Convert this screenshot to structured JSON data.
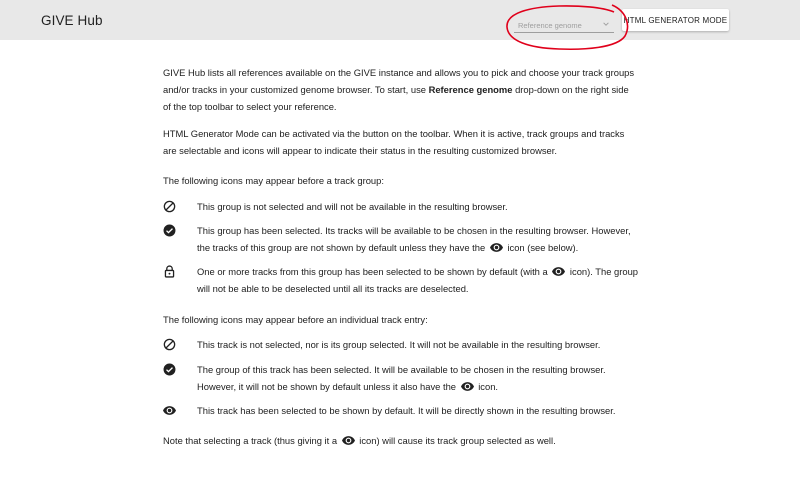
{
  "toolbar": {
    "title": "GIVE Hub",
    "reference_placeholder": "Reference genome",
    "mode_button": "HTML GENERATOR MODE"
  },
  "intro": {
    "p1_a": "GIVE Hub lists all references available on the GIVE instance and allows you to pick and choose your track groups and/or tracks in your customized genome browser. To start, use ",
    "p1_bold": "Reference genome",
    "p1_b": " drop-down on the right side of the top toolbar to select your reference.",
    "p2": "HTML Generator Mode can be activated via the button on the toolbar. When it is active, track groups and tracks are selectable and icons will appear to indicate their status in the resulting customized browser."
  },
  "group_section": {
    "heading": "The following icons may appear before a track group:",
    "items": [
      {
        "icon": "not-selected-icon",
        "text": "This group is not selected and will not be available in the resulting browser."
      },
      {
        "icon": "check-circle-icon",
        "text_a": "This group has been selected. Its tracks will be available to be chosen in the resulting browser. However, the tracks of this group are not shown by default unless they have the ",
        "text_b": " icon (see below)."
      },
      {
        "icon": "lock-icon",
        "text_a": "One or more tracks from this group has been selected to be shown by default (with a ",
        "text_b": " icon). The group will not be able to be deselected until all its tracks are deselected."
      }
    ]
  },
  "track_section": {
    "heading": "The following icons may appear before an individual track entry:",
    "items": [
      {
        "icon": "not-selected-icon",
        "text": "This track is not selected, nor is its group selected. It will not be available in the resulting browser."
      },
      {
        "icon": "check-circle-icon",
        "text_a": "The group of this track has been selected. It will be available to be chosen in the resulting browser. However, it will not be shown by default unless it also have the ",
        "text_b": " icon."
      },
      {
        "icon": "eye-icon",
        "text": "This track has been selected to be shown by default. It will be directly shown in the resulting browser."
      }
    ]
  },
  "note": {
    "text_a": "Note that selecting a track (thus giving it a ",
    "text_b": " icon) will cause its track group selected as well."
  },
  "colors": {
    "toolbar_bg": "#e8e8e8",
    "highlight": "#e0001b",
    "text": "#212121"
  }
}
